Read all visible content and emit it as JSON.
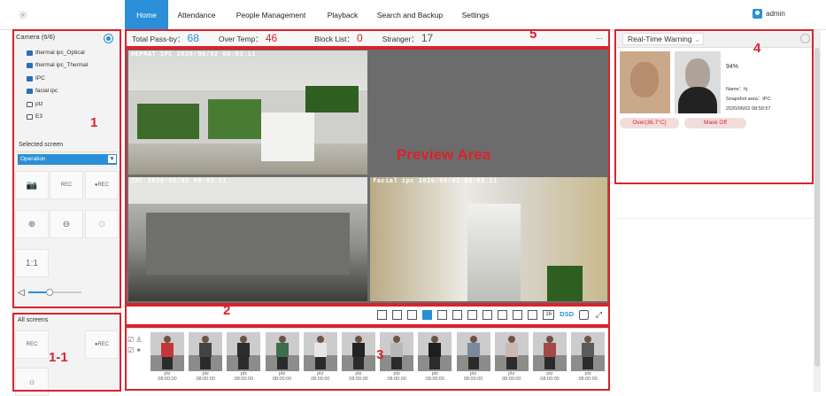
{
  "topbar": {
    "tabs": [
      {
        "label": "Home",
        "active": true
      },
      {
        "label": "Attendance"
      },
      {
        "label": "People Management"
      },
      {
        "label": "Playback"
      },
      {
        "label": "Search and Backup"
      },
      {
        "label": "Settings"
      }
    ],
    "user": "admin"
  },
  "left_panel": {
    "camera_header": "Camera (6/6)",
    "cameras": [
      {
        "name": "thermal ipc_Optical",
        "icon": "ipc-camera-icon"
      },
      {
        "name": "thermal ipc_Thermal",
        "icon": "ipc-camera-icon"
      },
      {
        "name": "IPC",
        "icon": "ipc-camera-icon"
      },
      {
        "name": "facial ipc",
        "icon": "ipc-camera-icon"
      },
      {
        "name": "ptz",
        "icon": "ptz-camera-icon"
      },
      {
        "name": "E3",
        "icon": "ptz-camera-icon"
      }
    ],
    "selected_screen_label": "Selected screen",
    "operation_value": "Operation",
    "tools": [
      "snapshot-icon",
      "record-icon",
      "encrypted-record-icon",
      "zoom-in-icon",
      "zoom-out-icon",
      "zoom-reset-icon",
      "original-ratio-icon"
    ],
    "ratio_label": "1:1",
    "volume": 0.4,
    "all_screens_label": "All screens"
  },
  "status": {
    "items": [
      {
        "label": "Total Pass-by：",
        "value": "68",
        "color": "#2a8fd8"
      },
      {
        "label": "Over Temp：",
        "value": "46",
        "color": "#d9232e"
      },
      {
        "label": "Block List：",
        "value": "0",
        "color": "#d9232e"
      },
      {
        "label": "Stranger：",
        "value": "17",
        "color": "#555555"
      }
    ],
    "more": "···"
  },
  "preview": {
    "area_label": "Preview Area",
    "tiles": [
      {
        "osd": "HEPMAT IPC        2020/06/02 08:03:11"
      },
      {
        "osd": ""
      },
      {
        "osd": "IPC                    2020/06/02 08:03:11"
      },
      {
        "osd": "facial ipc            2020/06/02 08:03:11"
      }
    ]
  },
  "layout_bar": {
    "selected_index": 3,
    "items": [
      "1",
      "2",
      "3",
      "4",
      "6",
      "8",
      "9",
      "10",
      "13",
      "16",
      "25",
      "36",
      "DSD",
      "custom",
      "fullscreen"
    ],
    "text16": "16",
    "dsd": "DSD",
    "fullscreen_glyph": "⤢"
  },
  "snapshots": {
    "items": [
      {
        "cam": "ptz",
        "time": "08:00:00"
      },
      {
        "cam": "ptz",
        "time": "08:00:00"
      },
      {
        "cam": "ptz",
        "time": "08:00:00"
      },
      {
        "cam": "ptz",
        "time": "08:00:00"
      },
      {
        "cam": "ptz",
        "time": "08:00:00"
      },
      {
        "cam": "ptz",
        "time": "08:00:00"
      },
      {
        "cam": "ptz",
        "time": "08:00:00"
      },
      {
        "cam": "ptz",
        "time": "08:00:00"
      },
      {
        "cam": "ptz",
        "time": "08:00:00"
      },
      {
        "cam": "ptz",
        "time": "08:00:00"
      },
      {
        "cam": "ptz",
        "time": "08:00:00"
      },
      {
        "cam": "ptz",
        "time": "08:00:00"
      }
    ]
  },
  "warning": {
    "mode": "Real-Time Warning",
    "similarity": "94%",
    "name_line": "Name：hj",
    "area_line": "Snapshot area：IPC",
    "time_line": "2020/06/02 08:59:57",
    "over_temp": "Over(36.7°C)",
    "mask": "Mask Off"
  },
  "annotations": {
    "n1": "1",
    "n1_1": "1-1",
    "n2": "2",
    "n3": "3",
    "n4": "4",
    "n5": "5"
  },
  "colors": {
    "accent": "#2a8fd8",
    "annotation_red": "#d9232e"
  }
}
